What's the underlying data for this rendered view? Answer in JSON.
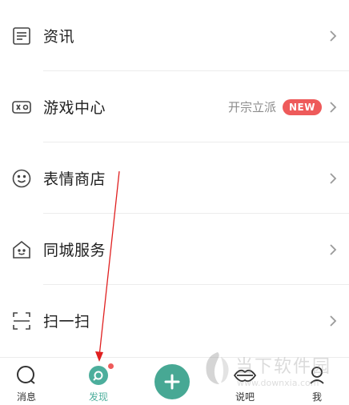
{
  "menu": {
    "items": [
      {
        "label": "资讯",
        "icon": "news-icon"
      },
      {
        "label": "游戏中心",
        "icon": "gamepad-icon",
        "extra": "开宗立派",
        "badge": "NEW"
      },
      {
        "label": "表情商店",
        "icon": "smiley-icon"
      },
      {
        "label": "同城服务",
        "icon": "house-face-icon"
      },
      {
        "label": "扫一扫",
        "icon": "scan-icon"
      }
    ]
  },
  "bottom_nav": {
    "items": [
      {
        "label": "消息",
        "icon": "message-bubble-icon"
      },
      {
        "label": "发现",
        "icon": "discover-icon",
        "active": true
      },
      {
        "label": "",
        "icon": "plus-icon"
      },
      {
        "label": "说吧",
        "icon": "lips-icon"
      },
      {
        "label": "我",
        "icon": "person-icon"
      }
    ]
  },
  "watermark": {
    "text": "当下软件园",
    "url": "www.downxia.com"
  },
  "colors": {
    "accent": "#47a894",
    "badge": "#ee5a5a",
    "annotation_arrow": "#e02020"
  }
}
